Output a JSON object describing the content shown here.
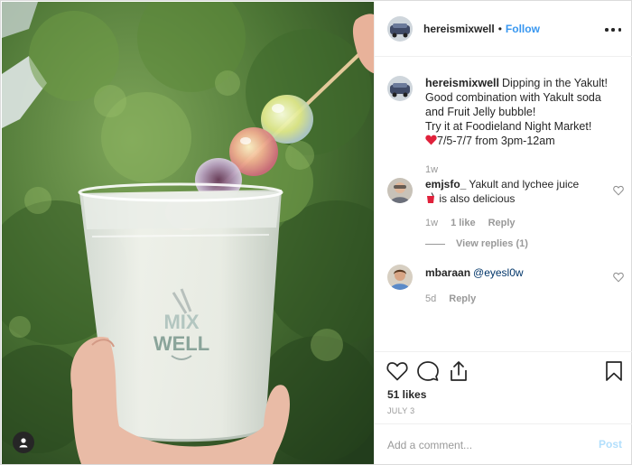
{
  "post": {
    "username": "hereismixwell",
    "follow_label": "Follow",
    "separator": "•",
    "caption_username": "hereismixwell",
    "caption_lines": [
      "Dipping in the Yakult!",
      "Good combination with Yakult soda",
      "and Fruit Jelly bubble!",
      "Try it at Foodieland Night Market!",
      "7/5-7/7 from 3pm-12am"
    ],
    "caption_time": "1w",
    "cup_logo_line1": "MIX",
    "cup_logo_line2": "WELL"
  },
  "comments": [
    {
      "username": "emjsfo_",
      "text_line1": "Yakult and lychee juice",
      "text_line2": "is also delicious",
      "time": "1w",
      "likes": "1 like",
      "reply_label": "Reply",
      "view_replies": "View replies (1)"
    },
    {
      "username": "mbaraan",
      "mention": "@eyesl0w",
      "time": "5d",
      "reply_label": "Reply"
    }
  ],
  "actions": {
    "likes_text": "51 likes",
    "date_text": "JULY 3"
  },
  "add_comment": {
    "placeholder": "Add a comment...",
    "post_label": "Post"
  },
  "colors": {
    "link_blue": "#3897f0",
    "post_disabled": "#b2dffc",
    "heart_red": "#ed4956"
  }
}
